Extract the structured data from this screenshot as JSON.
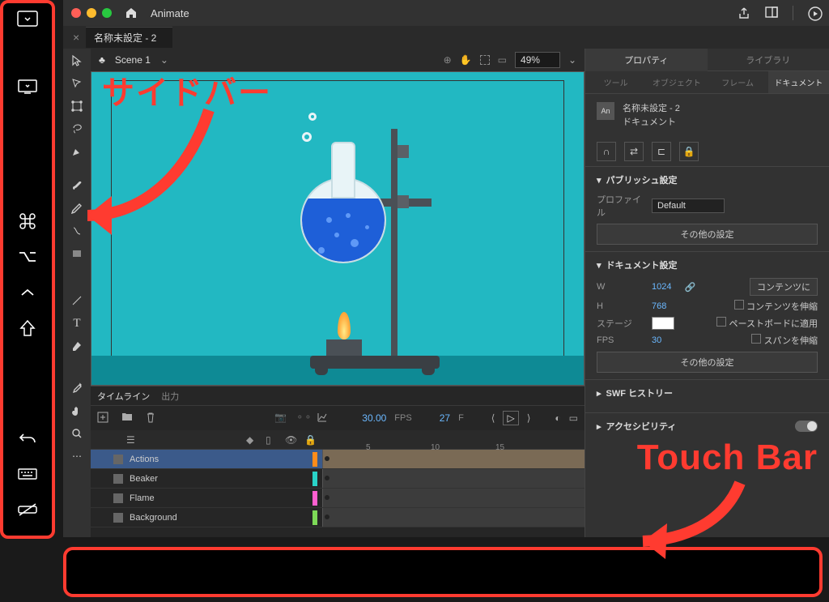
{
  "app": {
    "name": "Animate"
  },
  "doc_tab": "名称未設定 - 2",
  "scene": "Scene 1",
  "zoom": "49%",
  "timeline": {
    "tab_timeline": "タイムライン",
    "tab_output": "出力",
    "fps_label": "FPS",
    "fps_value": "30.00",
    "frame_label": "F",
    "frame_value": "27",
    "ruler": [
      "5",
      "10",
      "15"
    ],
    "layers": [
      {
        "name": "Actions",
        "color": "#ff8c1a"
      },
      {
        "name": "Beaker",
        "color": "#29d3c8"
      },
      {
        "name": "Flame",
        "color": "#ff5fd0"
      },
      {
        "name": "Background",
        "color": "#7dd957"
      }
    ]
  },
  "props": {
    "tab_property": "プロパティ",
    "tab_library": "ライブラリ",
    "sub_tool": "ツール",
    "sub_object": "オブジェクト",
    "sub_frame": "フレーム",
    "sub_document": "ドキュメント",
    "doc_name": "名称未設定 - 2",
    "doc_label": "ドキュメント",
    "sec_publish": "パブリッシュ設定",
    "profile_label": "プロファイル",
    "profile_value": "Default",
    "more_settings": "その他の設定",
    "sec_docset": "ドキュメント設定",
    "w_label": "W",
    "w_value": "1024",
    "h_label": "H",
    "h_value": "768",
    "match_contents": "コンテンツに",
    "scale_contents": "コンテンツを伸縮",
    "stage_label": "ステージ",
    "paste_apply": "ペーストボードに適用",
    "fps_label2": "FPS",
    "fps_value2": "30",
    "scale_span": "スパンを伸縮",
    "sec_swf": "SWF ヒストリー",
    "sec_access": "アクセシビリティ"
  },
  "annotations": {
    "sidebar": "サイドバー",
    "touchbar": "Touch Bar"
  }
}
